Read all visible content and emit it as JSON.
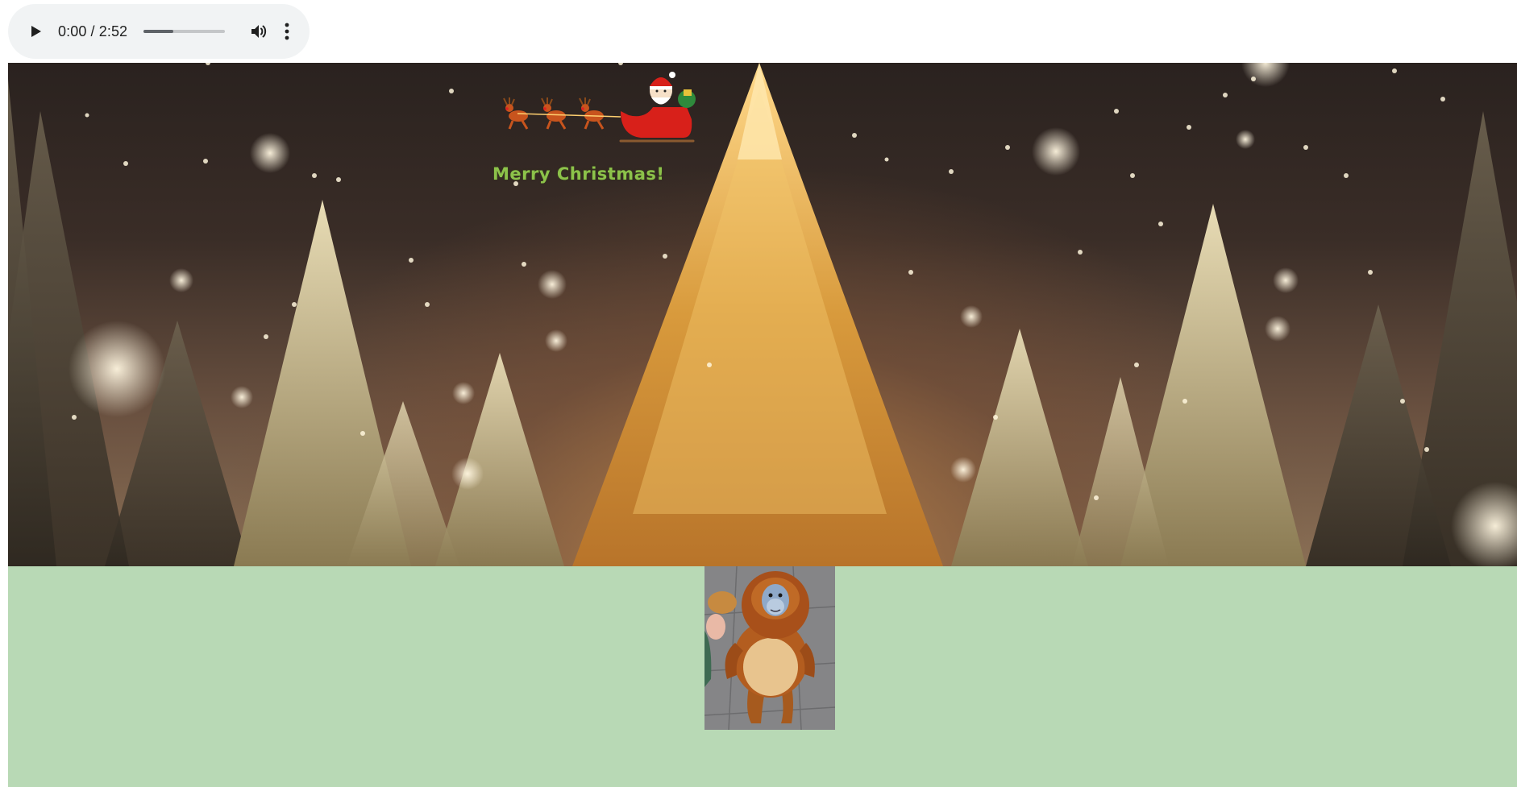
{
  "audio_player": {
    "time": "0:00 / 2:52",
    "progress_fraction": 0.36,
    "play_icon": "play-icon",
    "volume_icon": "volume-icon",
    "more_icon": "more-vertical-icon"
  },
  "banner": {
    "greeting": "Merry Christmas!",
    "sleigh_icon": "santa-sleigh-icon"
  },
  "colors": {
    "green_area": "#b8d9b5",
    "greeting": "#8cc24a",
    "player_bg": "#f1f3f4"
  }
}
